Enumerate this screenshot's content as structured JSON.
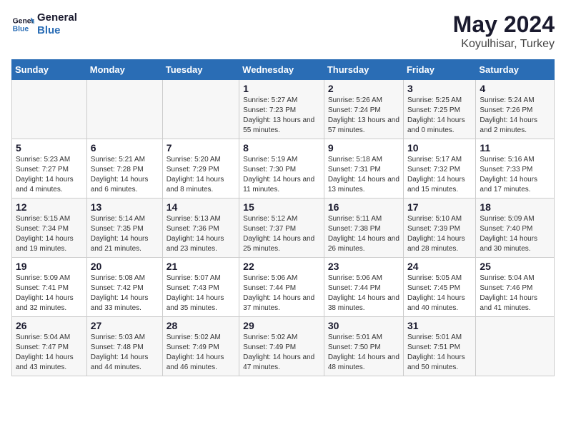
{
  "logo": {
    "line1": "General",
    "line2": "Blue"
  },
  "title": "May 2024",
  "subtitle": "Koyulhisar, Turkey",
  "weekdays": [
    "Sunday",
    "Monday",
    "Tuesday",
    "Wednesday",
    "Thursday",
    "Friday",
    "Saturday"
  ],
  "weeks": [
    [
      {
        "day": "",
        "sunrise": "",
        "sunset": "",
        "daylight": ""
      },
      {
        "day": "",
        "sunrise": "",
        "sunset": "",
        "daylight": ""
      },
      {
        "day": "",
        "sunrise": "",
        "sunset": "",
        "daylight": ""
      },
      {
        "day": "1",
        "sunrise": "Sunrise: 5:27 AM",
        "sunset": "Sunset: 7:23 PM",
        "daylight": "Daylight: 13 hours and 55 minutes."
      },
      {
        "day": "2",
        "sunrise": "Sunrise: 5:26 AM",
        "sunset": "Sunset: 7:24 PM",
        "daylight": "Daylight: 13 hours and 57 minutes."
      },
      {
        "day": "3",
        "sunrise": "Sunrise: 5:25 AM",
        "sunset": "Sunset: 7:25 PM",
        "daylight": "Daylight: 14 hours and 0 minutes."
      },
      {
        "day": "4",
        "sunrise": "Sunrise: 5:24 AM",
        "sunset": "Sunset: 7:26 PM",
        "daylight": "Daylight: 14 hours and 2 minutes."
      }
    ],
    [
      {
        "day": "5",
        "sunrise": "Sunrise: 5:23 AM",
        "sunset": "Sunset: 7:27 PM",
        "daylight": "Daylight: 14 hours and 4 minutes."
      },
      {
        "day": "6",
        "sunrise": "Sunrise: 5:21 AM",
        "sunset": "Sunset: 7:28 PM",
        "daylight": "Daylight: 14 hours and 6 minutes."
      },
      {
        "day": "7",
        "sunrise": "Sunrise: 5:20 AM",
        "sunset": "Sunset: 7:29 PM",
        "daylight": "Daylight: 14 hours and 8 minutes."
      },
      {
        "day": "8",
        "sunrise": "Sunrise: 5:19 AM",
        "sunset": "Sunset: 7:30 PM",
        "daylight": "Daylight: 14 hours and 11 minutes."
      },
      {
        "day": "9",
        "sunrise": "Sunrise: 5:18 AM",
        "sunset": "Sunset: 7:31 PM",
        "daylight": "Daylight: 14 hours and 13 minutes."
      },
      {
        "day": "10",
        "sunrise": "Sunrise: 5:17 AM",
        "sunset": "Sunset: 7:32 PM",
        "daylight": "Daylight: 14 hours and 15 minutes."
      },
      {
        "day": "11",
        "sunrise": "Sunrise: 5:16 AM",
        "sunset": "Sunset: 7:33 PM",
        "daylight": "Daylight: 14 hours and 17 minutes."
      }
    ],
    [
      {
        "day": "12",
        "sunrise": "Sunrise: 5:15 AM",
        "sunset": "Sunset: 7:34 PM",
        "daylight": "Daylight: 14 hours and 19 minutes."
      },
      {
        "day": "13",
        "sunrise": "Sunrise: 5:14 AM",
        "sunset": "Sunset: 7:35 PM",
        "daylight": "Daylight: 14 hours and 21 minutes."
      },
      {
        "day": "14",
        "sunrise": "Sunrise: 5:13 AM",
        "sunset": "Sunset: 7:36 PM",
        "daylight": "Daylight: 14 hours and 23 minutes."
      },
      {
        "day": "15",
        "sunrise": "Sunrise: 5:12 AM",
        "sunset": "Sunset: 7:37 PM",
        "daylight": "Daylight: 14 hours and 25 minutes."
      },
      {
        "day": "16",
        "sunrise": "Sunrise: 5:11 AM",
        "sunset": "Sunset: 7:38 PM",
        "daylight": "Daylight: 14 hours and 26 minutes."
      },
      {
        "day": "17",
        "sunrise": "Sunrise: 5:10 AM",
        "sunset": "Sunset: 7:39 PM",
        "daylight": "Daylight: 14 hours and 28 minutes."
      },
      {
        "day": "18",
        "sunrise": "Sunrise: 5:09 AM",
        "sunset": "Sunset: 7:40 PM",
        "daylight": "Daylight: 14 hours and 30 minutes."
      }
    ],
    [
      {
        "day": "19",
        "sunrise": "Sunrise: 5:09 AM",
        "sunset": "Sunset: 7:41 PM",
        "daylight": "Daylight: 14 hours and 32 minutes."
      },
      {
        "day": "20",
        "sunrise": "Sunrise: 5:08 AM",
        "sunset": "Sunset: 7:42 PM",
        "daylight": "Daylight: 14 hours and 33 minutes."
      },
      {
        "day": "21",
        "sunrise": "Sunrise: 5:07 AM",
        "sunset": "Sunset: 7:43 PM",
        "daylight": "Daylight: 14 hours and 35 minutes."
      },
      {
        "day": "22",
        "sunrise": "Sunrise: 5:06 AM",
        "sunset": "Sunset: 7:44 PM",
        "daylight": "Daylight: 14 hours and 37 minutes."
      },
      {
        "day": "23",
        "sunrise": "Sunrise: 5:06 AM",
        "sunset": "Sunset: 7:44 PM",
        "daylight": "Daylight: 14 hours and 38 minutes."
      },
      {
        "day": "24",
        "sunrise": "Sunrise: 5:05 AM",
        "sunset": "Sunset: 7:45 PM",
        "daylight": "Daylight: 14 hours and 40 minutes."
      },
      {
        "day": "25",
        "sunrise": "Sunrise: 5:04 AM",
        "sunset": "Sunset: 7:46 PM",
        "daylight": "Daylight: 14 hours and 41 minutes."
      }
    ],
    [
      {
        "day": "26",
        "sunrise": "Sunrise: 5:04 AM",
        "sunset": "Sunset: 7:47 PM",
        "daylight": "Daylight: 14 hours and 43 minutes."
      },
      {
        "day": "27",
        "sunrise": "Sunrise: 5:03 AM",
        "sunset": "Sunset: 7:48 PM",
        "daylight": "Daylight: 14 hours and 44 minutes."
      },
      {
        "day": "28",
        "sunrise": "Sunrise: 5:02 AM",
        "sunset": "Sunset: 7:49 PM",
        "daylight": "Daylight: 14 hours and 46 minutes."
      },
      {
        "day": "29",
        "sunrise": "Sunrise: 5:02 AM",
        "sunset": "Sunset: 7:49 PM",
        "daylight": "Daylight: 14 hours and 47 minutes."
      },
      {
        "day": "30",
        "sunrise": "Sunrise: 5:01 AM",
        "sunset": "Sunset: 7:50 PM",
        "daylight": "Daylight: 14 hours and 48 minutes."
      },
      {
        "day": "31",
        "sunrise": "Sunrise: 5:01 AM",
        "sunset": "Sunset: 7:51 PM",
        "daylight": "Daylight: 14 hours and 50 minutes."
      },
      {
        "day": "",
        "sunrise": "",
        "sunset": "",
        "daylight": ""
      }
    ]
  ]
}
